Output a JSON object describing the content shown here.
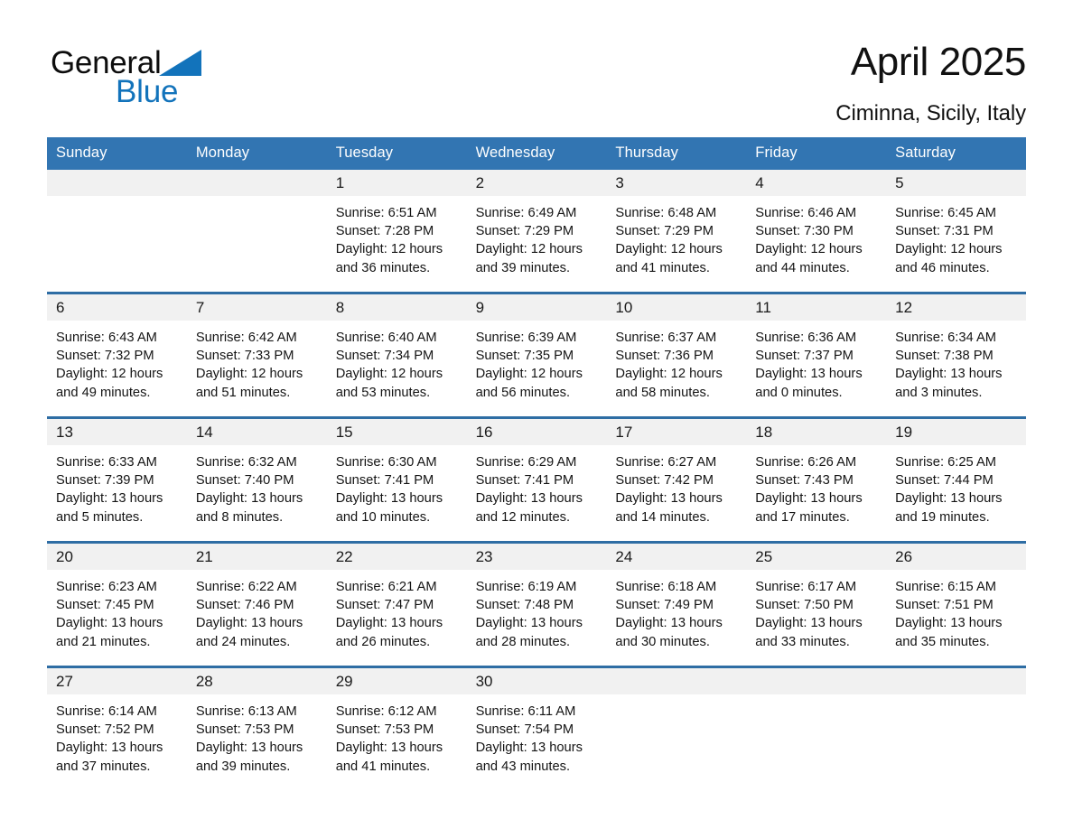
{
  "brand": {
    "name_part1": "General",
    "name_part2": "Blue",
    "triangle_color": "#1273bb"
  },
  "header": {
    "title": "April 2025",
    "subtitle": "Ciminna, Sicily, Italy"
  },
  "theme": {
    "header_blue": "#3275b2",
    "row_divider_blue": "#2e6da4",
    "day_band_gray": "#f1f1f1"
  },
  "weekdays": [
    "Sunday",
    "Monday",
    "Tuesday",
    "Wednesday",
    "Thursday",
    "Friday",
    "Saturday"
  ],
  "weeks": [
    [
      {
        "day": "",
        "sunrise": "",
        "sunset": "",
        "daylight_line1": "",
        "daylight_line2": "",
        "empty": true
      },
      {
        "day": "",
        "sunrise": "",
        "sunset": "",
        "daylight_line1": "",
        "daylight_line2": "",
        "empty": true
      },
      {
        "day": "1",
        "sunrise": "Sunrise: 6:51 AM",
        "sunset": "Sunset: 7:28 PM",
        "daylight_line1": "Daylight: 12 hours",
        "daylight_line2": "and 36 minutes."
      },
      {
        "day": "2",
        "sunrise": "Sunrise: 6:49 AM",
        "sunset": "Sunset: 7:29 PM",
        "daylight_line1": "Daylight: 12 hours",
        "daylight_line2": "and 39 minutes."
      },
      {
        "day": "3",
        "sunrise": "Sunrise: 6:48 AM",
        "sunset": "Sunset: 7:29 PM",
        "daylight_line1": "Daylight: 12 hours",
        "daylight_line2": "and 41 minutes."
      },
      {
        "day": "4",
        "sunrise": "Sunrise: 6:46 AM",
        "sunset": "Sunset: 7:30 PM",
        "daylight_line1": "Daylight: 12 hours",
        "daylight_line2": "and 44 minutes."
      },
      {
        "day": "5",
        "sunrise": "Sunrise: 6:45 AM",
        "sunset": "Sunset: 7:31 PM",
        "daylight_line1": "Daylight: 12 hours",
        "daylight_line2": "and 46 minutes."
      }
    ],
    [
      {
        "day": "6",
        "sunrise": "Sunrise: 6:43 AM",
        "sunset": "Sunset: 7:32 PM",
        "daylight_line1": "Daylight: 12 hours",
        "daylight_line2": "and 49 minutes."
      },
      {
        "day": "7",
        "sunrise": "Sunrise: 6:42 AM",
        "sunset": "Sunset: 7:33 PM",
        "daylight_line1": "Daylight: 12 hours",
        "daylight_line2": "and 51 minutes."
      },
      {
        "day": "8",
        "sunrise": "Sunrise: 6:40 AM",
        "sunset": "Sunset: 7:34 PM",
        "daylight_line1": "Daylight: 12 hours",
        "daylight_line2": "and 53 minutes."
      },
      {
        "day": "9",
        "sunrise": "Sunrise: 6:39 AM",
        "sunset": "Sunset: 7:35 PM",
        "daylight_line1": "Daylight: 12 hours",
        "daylight_line2": "and 56 minutes."
      },
      {
        "day": "10",
        "sunrise": "Sunrise: 6:37 AM",
        "sunset": "Sunset: 7:36 PM",
        "daylight_line1": "Daylight: 12 hours",
        "daylight_line2": "and 58 minutes."
      },
      {
        "day": "11",
        "sunrise": "Sunrise: 6:36 AM",
        "sunset": "Sunset: 7:37 PM",
        "daylight_line1": "Daylight: 13 hours",
        "daylight_line2": "and 0 minutes."
      },
      {
        "day": "12",
        "sunrise": "Sunrise: 6:34 AM",
        "sunset": "Sunset: 7:38 PM",
        "daylight_line1": "Daylight: 13 hours",
        "daylight_line2": "and 3 minutes."
      }
    ],
    [
      {
        "day": "13",
        "sunrise": "Sunrise: 6:33 AM",
        "sunset": "Sunset: 7:39 PM",
        "daylight_line1": "Daylight: 13 hours",
        "daylight_line2": "and 5 minutes."
      },
      {
        "day": "14",
        "sunrise": "Sunrise: 6:32 AM",
        "sunset": "Sunset: 7:40 PM",
        "daylight_line1": "Daylight: 13 hours",
        "daylight_line2": "and 8 minutes."
      },
      {
        "day": "15",
        "sunrise": "Sunrise: 6:30 AM",
        "sunset": "Sunset: 7:41 PM",
        "daylight_line1": "Daylight: 13 hours",
        "daylight_line2": "and 10 minutes."
      },
      {
        "day": "16",
        "sunrise": "Sunrise: 6:29 AM",
        "sunset": "Sunset: 7:41 PM",
        "daylight_line1": "Daylight: 13 hours",
        "daylight_line2": "and 12 minutes."
      },
      {
        "day": "17",
        "sunrise": "Sunrise: 6:27 AM",
        "sunset": "Sunset: 7:42 PM",
        "daylight_line1": "Daylight: 13 hours",
        "daylight_line2": "and 14 minutes."
      },
      {
        "day": "18",
        "sunrise": "Sunrise: 6:26 AM",
        "sunset": "Sunset: 7:43 PM",
        "daylight_line1": "Daylight: 13 hours",
        "daylight_line2": "and 17 minutes."
      },
      {
        "day": "19",
        "sunrise": "Sunrise: 6:25 AM",
        "sunset": "Sunset: 7:44 PM",
        "daylight_line1": "Daylight: 13 hours",
        "daylight_line2": "and 19 minutes."
      }
    ],
    [
      {
        "day": "20",
        "sunrise": "Sunrise: 6:23 AM",
        "sunset": "Sunset: 7:45 PM",
        "daylight_line1": "Daylight: 13 hours",
        "daylight_line2": "and 21 minutes."
      },
      {
        "day": "21",
        "sunrise": "Sunrise: 6:22 AM",
        "sunset": "Sunset: 7:46 PM",
        "daylight_line1": "Daylight: 13 hours",
        "daylight_line2": "and 24 minutes."
      },
      {
        "day": "22",
        "sunrise": "Sunrise: 6:21 AM",
        "sunset": "Sunset: 7:47 PM",
        "daylight_line1": "Daylight: 13 hours",
        "daylight_line2": "and 26 minutes."
      },
      {
        "day": "23",
        "sunrise": "Sunrise: 6:19 AM",
        "sunset": "Sunset: 7:48 PM",
        "daylight_line1": "Daylight: 13 hours",
        "daylight_line2": "and 28 minutes."
      },
      {
        "day": "24",
        "sunrise": "Sunrise: 6:18 AM",
        "sunset": "Sunset: 7:49 PM",
        "daylight_line1": "Daylight: 13 hours",
        "daylight_line2": "and 30 minutes."
      },
      {
        "day": "25",
        "sunrise": "Sunrise: 6:17 AM",
        "sunset": "Sunset: 7:50 PM",
        "daylight_line1": "Daylight: 13 hours",
        "daylight_line2": "and 33 minutes."
      },
      {
        "day": "26",
        "sunrise": "Sunrise: 6:15 AM",
        "sunset": "Sunset: 7:51 PM",
        "daylight_line1": "Daylight: 13 hours",
        "daylight_line2": "and 35 minutes."
      }
    ],
    [
      {
        "day": "27",
        "sunrise": "Sunrise: 6:14 AM",
        "sunset": "Sunset: 7:52 PM",
        "daylight_line1": "Daylight: 13 hours",
        "daylight_line2": "and 37 minutes."
      },
      {
        "day": "28",
        "sunrise": "Sunrise: 6:13 AM",
        "sunset": "Sunset: 7:53 PM",
        "daylight_line1": "Daylight: 13 hours",
        "daylight_line2": "and 39 minutes."
      },
      {
        "day": "29",
        "sunrise": "Sunrise: 6:12 AM",
        "sunset": "Sunset: 7:53 PM",
        "daylight_line1": "Daylight: 13 hours",
        "daylight_line2": "and 41 minutes."
      },
      {
        "day": "30",
        "sunrise": "Sunrise: 6:11 AM",
        "sunset": "Sunset: 7:54 PM",
        "daylight_line1": "Daylight: 13 hours",
        "daylight_line2": "and 43 minutes."
      },
      {
        "day": "",
        "sunrise": "",
        "sunset": "",
        "daylight_line1": "",
        "daylight_line2": "",
        "empty": true
      },
      {
        "day": "",
        "sunrise": "",
        "sunset": "",
        "daylight_line1": "",
        "daylight_line2": "",
        "empty": true
      },
      {
        "day": "",
        "sunrise": "",
        "sunset": "",
        "daylight_line1": "",
        "daylight_line2": "",
        "empty": true
      }
    ]
  ]
}
